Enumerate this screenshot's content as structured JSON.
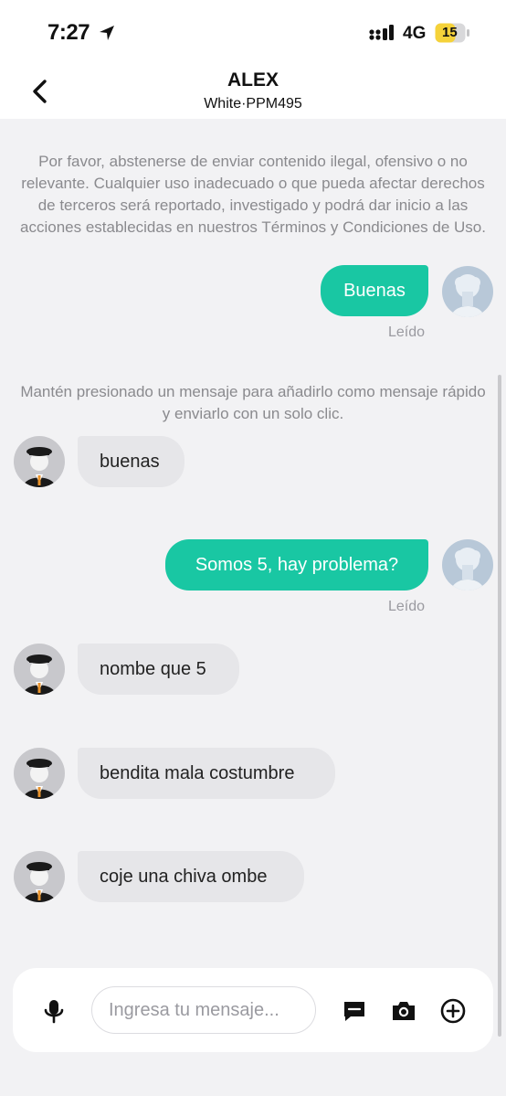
{
  "status_bar": {
    "time": "7:27",
    "network": "4G",
    "battery": "15",
    "icons": [
      "location-arrow-icon",
      "signal-icon",
      "battery-icon"
    ]
  },
  "header": {
    "contact_name": "ALEX",
    "vehicle": "White·PPM495"
  },
  "notices": {
    "policy": "Por favor, abstenerse de enviar contenido ilegal, ofensivo o no relevante. Cualquier uso inadecuado o que pueda afectar derechos de terceros será reportado, investigado y podrá dar inicio a las acciones establecidas en nuestros Términos y Condiciones de Uso.",
    "quick_tip": "Mantén presionado un mensaje para añadirlo como mensaje rápido y enviarlo con un solo clic."
  },
  "messages": [
    {
      "from": "me",
      "text": "Buenas",
      "status": "Leído"
    },
    {
      "from": "driver",
      "text": "buenas"
    },
    {
      "from": "me",
      "text": "Somos 5, hay problema?",
      "status": "Leído"
    },
    {
      "from": "driver",
      "text": "nombe que 5"
    },
    {
      "from": "driver",
      "text": "bendita mala costumbre"
    },
    {
      "from": "driver",
      "text": "coje una chiva ombe"
    }
  ],
  "composer": {
    "placeholder": "Ingresa tu mensaje...",
    "icons": [
      "microphone-icon",
      "quick-message-icon",
      "camera-icon",
      "plus-circle-icon"
    ]
  },
  "colors": {
    "outgoing_bubble": "#19c7a3",
    "incoming_bubble": "#e6e6e9",
    "background": "#f2f2f4",
    "battery_fill": "#f5d23a"
  }
}
